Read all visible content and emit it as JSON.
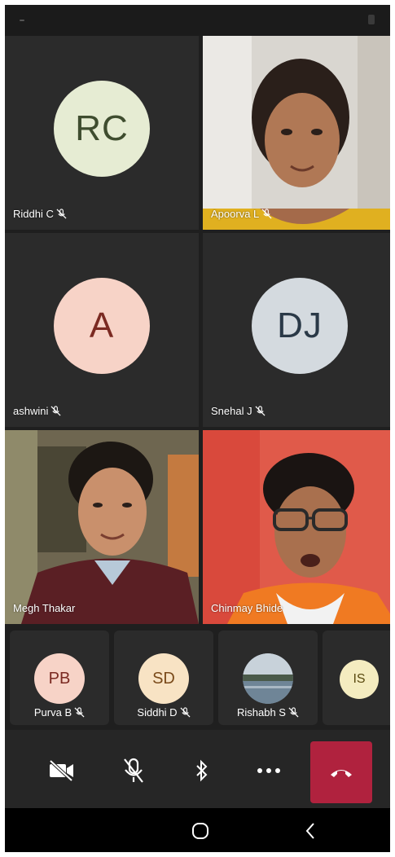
{
  "tiles": [
    {
      "name": "Riddhi C",
      "initials": "RC",
      "type": "avatar",
      "avatar_bg": "#e6ecd3",
      "avatar_fg": "#3f4d2f",
      "muted": true
    },
    {
      "name": "Apoorva L",
      "type": "video",
      "muted": true
    },
    {
      "name": "ashwini",
      "initials": "A",
      "type": "avatar",
      "avatar_bg": "#f7d3c7",
      "avatar_fg": "#7b2a22",
      "muted": true
    },
    {
      "name": "Snehal J",
      "initials": "DJ",
      "type": "avatar",
      "avatar_bg": "#d4dadf",
      "avatar_fg": "#2a3947",
      "muted": true
    },
    {
      "name": "Megh Thakar",
      "type": "video",
      "muted": false
    },
    {
      "name": "Chinmay Bhide",
      "type": "video",
      "muted": false,
      "active_speaker": true
    }
  ],
  "participants": [
    {
      "name": "Purva B",
      "initials": "PB",
      "avatar_bg": "#f7d3c7",
      "avatar_fg": "#7b2a22",
      "muted": true
    },
    {
      "name": "Siddhi D",
      "initials": "SD",
      "avatar_bg": "#f8e3c4",
      "avatar_fg": "#7a4a1a",
      "muted": true
    },
    {
      "name": "Rishabh S",
      "initials": "",
      "avatar_bg": "#6f8597",
      "muted": true,
      "photo": true
    },
    {
      "name": "",
      "initials": "IS",
      "avatar_bg": "#f4ecc0",
      "avatar_fg": "#5a4a10",
      "muted": false
    }
  ],
  "controls": {
    "camera_icon": "camera-off-icon",
    "mic_icon": "mic-off-icon",
    "bluetooth_icon": "bluetooth-icon",
    "more_icon": "more-icon",
    "end_call_icon": "end-call-icon",
    "end_call_color": "#b0223e"
  },
  "nav": {
    "home_icon": "home-circle-icon",
    "back_icon": "back-chevron-icon"
  }
}
